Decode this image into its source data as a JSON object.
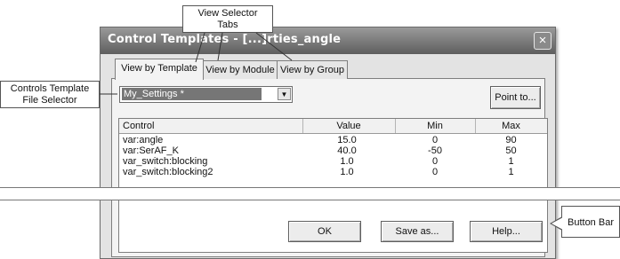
{
  "dialog": {
    "title": "Control Templates - [...]rties_angle",
    "close_glyph": "×"
  },
  "tabs": [
    {
      "label": "View by Template",
      "active": true
    },
    {
      "label": "View by Module",
      "active": false
    },
    {
      "label": "View by Group",
      "active": false
    }
  ],
  "template_selector": {
    "value": "My_Settings *"
  },
  "point_to_label": "Point to...",
  "table": {
    "headers": [
      "Control",
      "Value",
      "Min",
      "Max"
    ],
    "rows": [
      {
        "control": "var:angle",
        "value": "15.0",
        "min": "0",
        "max": "90"
      },
      {
        "control": "var:SerAF_K",
        "value": "40.0",
        "min": "-50",
        "max": "50"
      },
      {
        "control": "var_switch:blocking",
        "value": "1.0",
        "min": "0",
        "max": "1"
      },
      {
        "control": "var_switch:blocking2",
        "value": "1.0",
        "min": "0",
        "max": "1"
      }
    ]
  },
  "buttons": {
    "ok": "OK",
    "save_as": "Save as...",
    "help": "Help..."
  },
  "callouts": {
    "view_selector": {
      "line1": "View Selector",
      "line2": "Tabs"
    },
    "template_file_selector": {
      "line1": "Controls Template",
      "line2": "File Selector"
    },
    "button_bar": "Button Bar"
  }
}
